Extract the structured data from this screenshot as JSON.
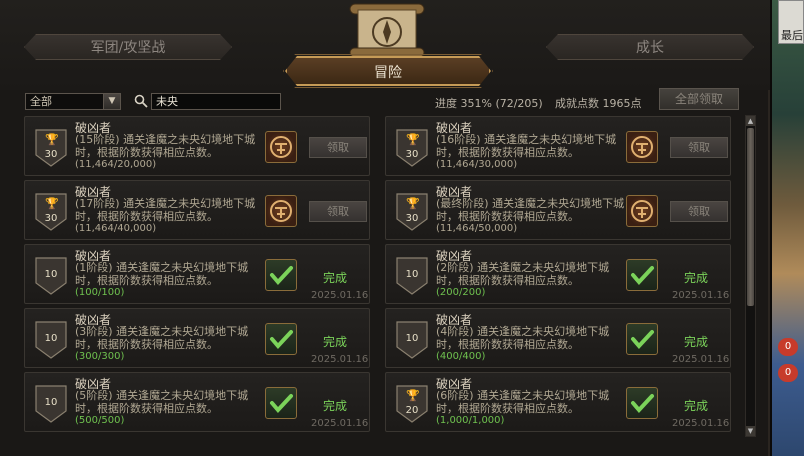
{
  "tabs": {
    "left": "军团/攻坚战",
    "active": "冒险",
    "right": "成长"
  },
  "filter": {
    "category_value": "全部",
    "search_value": "未央"
  },
  "summary": {
    "progress": "进度 351% (72/205)",
    "points": "成就点数 1965点",
    "claim_all": "全部领取"
  },
  "side": {
    "top_label": "最后",
    "badges": [
      "0",
      "0"
    ]
  },
  "achievements": [
    {
      "badge": "30",
      "trophy": true,
      "title": "破凶者",
      "desc": "(15阶段) 通关逢魔之未央幻境地下城时，根据阶数获得相应点数。",
      "progress": "(11,464/20,000)",
      "completed": false,
      "button": "领取",
      "date": ""
    },
    {
      "badge": "30",
      "trophy": true,
      "title": "破凶者",
      "desc": "(16阶段) 通关逢魔之未央幻境地下城时，根据阶数获得相应点数。",
      "progress": "(11,464/30,000)",
      "completed": false,
      "button": "领取",
      "date": ""
    },
    {
      "badge": "30",
      "trophy": true,
      "title": "破凶者",
      "desc": "(17阶段) 通关逢魔之未央幻境地下城时，根据阶数获得相应点数。",
      "progress": "(11,464/40,000)",
      "completed": false,
      "button": "领取",
      "date": ""
    },
    {
      "badge": "30",
      "trophy": true,
      "title": "破凶者",
      "desc": "(最终阶段) 通关逢魔之未央幻境地下城时，根据阶数获得相应点数。",
      "progress": "(11,464/50,000)",
      "completed": false,
      "button": "领取",
      "date": ""
    },
    {
      "badge": "10",
      "trophy": false,
      "title": "破凶者",
      "desc": "(1阶段) 通关逢魔之未央幻境地下城时，根据阶数获得相应点数。",
      "progress": "(100/100)",
      "completed": true,
      "button": "完成",
      "date": "2025.01.16"
    },
    {
      "badge": "10",
      "trophy": false,
      "title": "破凶者",
      "desc": "(2阶段) 通关逢魔之未央幻境地下城时，根据阶数获得相应点数。",
      "progress": "(200/200)",
      "completed": true,
      "button": "完成",
      "date": "2025.01.16"
    },
    {
      "badge": "10",
      "trophy": false,
      "title": "破凶者",
      "desc": "(3阶段) 通关逢魔之未央幻境地下城时，根据阶数获得相应点数。",
      "progress": "(300/300)",
      "completed": true,
      "button": "完成",
      "date": "2025.01.16"
    },
    {
      "badge": "10",
      "trophy": false,
      "title": "破凶者",
      "desc": "(4阶段) 通关逢魔之未央幻境地下城时，根据阶数获得相应点数。",
      "progress": "(400/400)",
      "completed": true,
      "button": "完成",
      "date": "2025.01.16"
    },
    {
      "badge": "10",
      "trophy": false,
      "title": "破凶者",
      "desc": "(5阶段) 通关逢魔之未央幻境地下城时，根据阶数获得相应点数。",
      "progress": "(500/500)",
      "completed": true,
      "button": "完成",
      "date": "2025.01.16"
    },
    {
      "badge": "20",
      "trophy": true,
      "title": "破凶者",
      "desc": "(6阶段) 通关逢魔之未央幻境地下城时，根据阶数获得相应点数。",
      "progress": "(1,000/1,000)",
      "completed": true,
      "button": "完成",
      "date": "2025.01.16"
    }
  ]
}
